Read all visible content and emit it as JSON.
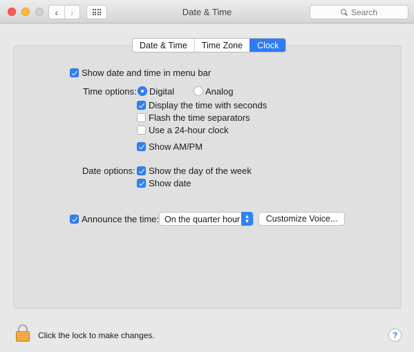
{
  "window": {
    "title": "Date & Time",
    "search_placeholder": "Search",
    "nav_back": "‹",
    "nav_forward": "›"
  },
  "tabs": [
    {
      "label": "Date & Time",
      "active": false
    },
    {
      "label": "Time Zone",
      "active": false
    },
    {
      "label": "Clock",
      "active": true
    }
  ],
  "clock": {
    "show_in_menu_bar": {
      "label": "Show date and time in menu bar",
      "checked": true
    },
    "time_options_label": "Time options:",
    "time_style": [
      {
        "label": "Digital",
        "selected": true
      },
      {
        "label": "Analog",
        "selected": false
      }
    ],
    "time_checkboxes": [
      {
        "label": "Display the time with seconds",
        "checked": true
      },
      {
        "label": "Flash the time separators",
        "checked": false
      },
      {
        "label": "Use a 24-hour clock",
        "checked": false
      },
      {
        "label": "Show AM/PM",
        "checked": true
      }
    ],
    "date_options_label": "Date options:",
    "date_checkboxes": [
      {
        "label": "Show the day of the week",
        "checked": true
      },
      {
        "label": "Show date",
        "checked": true
      }
    ],
    "announce": {
      "label": "Announce the time:",
      "checked": true,
      "selected_option": "On the quarter hour",
      "customize_label": "Customize Voice..."
    }
  },
  "footer": {
    "lock_text": "Click the lock to make changes.",
    "help_label": "?"
  },
  "colors": {
    "accent": "#2f80f6"
  }
}
